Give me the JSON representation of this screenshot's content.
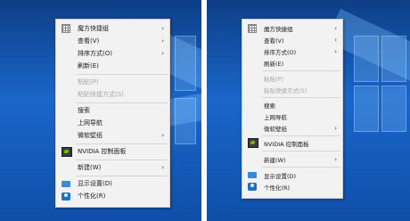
{
  "left_menu": {
    "items": [
      {
        "label": "魔方快捷组",
        "arrow": "›"
      },
      {
        "label": "查看(V)",
        "arrow": "›"
      },
      {
        "label": "排序方式(O)",
        "arrow": "›"
      },
      {
        "label": "刷新(E)"
      },
      {
        "label": "粘贴(P)"
      },
      {
        "label": "粘贴快捷方式(S)"
      },
      {
        "label": "搜索"
      },
      {
        "label": "上网导航"
      },
      {
        "label": "微软壁纸",
        "arrow": "›"
      },
      {
        "label": "NVIDIA 控制面板"
      },
      {
        "label": "新建(W)",
        "arrow": "›"
      },
      {
        "label": "显示设置(D)"
      },
      {
        "label": "个性化(R)"
      }
    ]
  },
  "right_menu": {
    "items": [
      {
        "label": "魔方快捷组",
        "arrow": "›"
      },
      {
        "label": "查看(V)",
        "arrow": "›"
      },
      {
        "label": "排序方式(O)",
        "arrow": "›"
      },
      {
        "label": "刷新(E)"
      },
      {
        "label": "粘贴(P)"
      },
      {
        "label": "粘贴快捷方式(S)"
      },
      {
        "label": "搜索"
      },
      {
        "label": "上网导航"
      },
      {
        "label": "微软壁纸",
        "arrow": "›"
      },
      {
        "label": "NVIDIA 控制面板"
      },
      {
        "label": "新建(W)",
        "arrow": "›"
      },
      {
        "label": "显示设置(D)"
      },
      {
        "label": "个性化(R)"
      }
    ]
  }
}
